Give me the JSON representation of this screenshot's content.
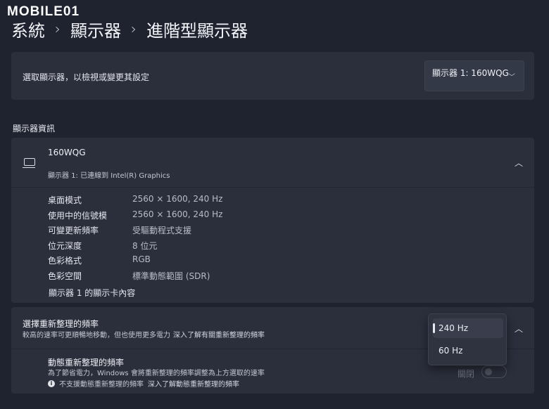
{
  "watermark": "MOBILE01",
  "breadcrumb": [
    "系統",
    "顯示器",
    "進階型顯示器"
  ],
  "select": {
    "label": "選取顯示器，以檢視或變更其設定",
    "value": "顯示器 1: 160WQG"
  },
  "info": {
    "section_title": "顯示器資訊",
    "name": "160WQG",
    "subtitle": "顯示器 1: 已連線到 Intel(R) Graphics",
    "rows": [
      {
        "k": "桌面模式",
        "v": "2560 × 1600, 240 Hz"
      },
      {
        "k": "使用中的信號模",
        "v": "2560 × 1600, 240 Hz"
      },
      {
        "k": "可變更新頻率",
        "v": "受驅動程式支援"
      },
      {
        "k": "位元深度",
        "v": "8 位元"
      },
      {
        "k": "色彩格式",
        "v": "RGB"
      },
      {
        "k": "色彩空間",
        "v": "標準動態範圍 (SDR)"
      }
    ],
    "adapter_link": "顯示器 1 的顯示卡內容"
  },
  "refresh": {
    "title": "選擇重新整理的頻率",
    "desc": "較高的速率可更順暢地移動，但也使用更多電力",
    "desc_link": "深入了解有關重新整理的頻率",
    "options": [
      "240 Hz",
      "60 Hz"
    ],
    "selected": "240 Hz"
  },
  "dynamic": {
    "title": "動態重新整理的頻率",
    "desc": "為了節省電力，Windows 會將重新整理的頻率調整為上方選取的速率",
    "note": "不支援動態重新整理的頻率",
    "note_link": "深入了解動態重新整理的頻率",
    "toggle_label": "關閉",
    "toggle_on": false
  },
  "icons": {
    "monitor": "monitor-icon",
    "chevron": "chevron-down-icon",
    "collapse": "chevron-up-icon",
    "info": "info-icon"
  },
  "colors": {
    "background": "#1f2330",
    "card": "#2b2f3c"
  }
}
